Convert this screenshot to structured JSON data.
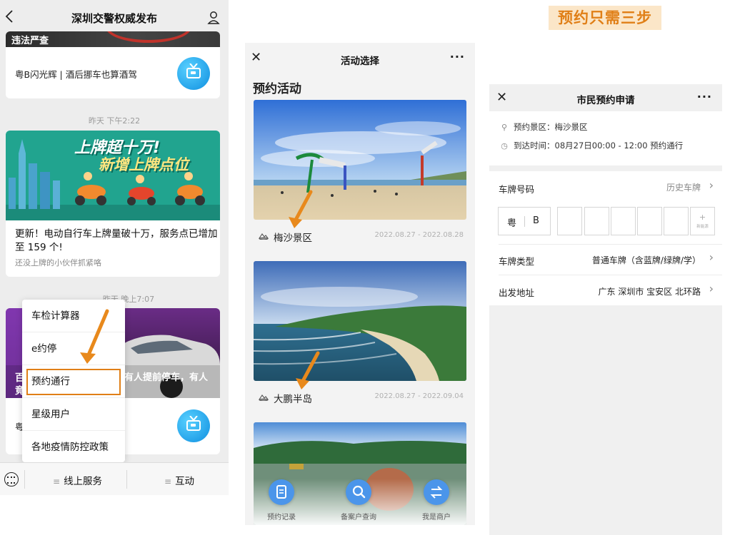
{
  "panel1": {
    "title": "深圳交警权威发布",
    "card_top_caption": "违法严查",
    "card1_text": "粤B闪光辉 | 酒后挪车也算酒驾",
    "time1": "昨天 下午2:22",
    "banner_line1": "上牌超十万!",
    "banner_line2": "新增上牌点位",
    "card2_title": "更新！电动自行车上牌量破十万，服务点已增加至 159 个!",
    "card2_sub": "还没上牌的小伙伴抓紧咯",
    "time2": "昨天 晚上7:07",
    "photo_overlay_left": "百",
    "photo_overlay_left2": "竟",
    "photo_overlay_right": "有人提前停车，有人",
    "card3_partial": "粤",
    "menu": [
      "车检计算器",
      "e约停",
      "预约通行",
      "星级用户",
      "各地疫情防控政策"
    ],
    "bottom_tabs": [
      "线上服务",
      "互动"
    ],
    "highlight_color": "#e07f17"
  },
  "panel2": {
    "title": "活动选择",
    "section_title": "预约活动",
    "activities": [
      {
        "name": "梅沙景区",
        "date": "2022.08.27 - 2022.08.28"
      },
      {
        "name": "大鹏半岛",
        "date": "2022.08.27 - 2022.09.04"
      }
    ],
    "fabs": [
      "预约记录",
      "备案户查询",
      "我是商户"
    ],
    "fab_color": "#4b95ea"
  },
  "panel3": {
    "banner": "预约只需三步",
    "title": "市民预约申请",
    "scenic_label": "预约景区：梅沙景区",
    "arrival_label": "到达时间：08月27日00:00 - 12:00 预约通行",
    "plate_label": "车牌号码",
    "history_label": "历史车牌",
    "plate_prefix": "粤",
    "plate_letter": "B",
    "new_energy_plus": "+",
    "new_energy_text": "新能源",
    "type_label": "车牌类型",
    "type_value": "普通车牌（含蓝牌/绿牌/学）",
    "origin_label": "出发地址",
    "origin_value": "广东 深圳市 宝安区 北环路"
  }
}
